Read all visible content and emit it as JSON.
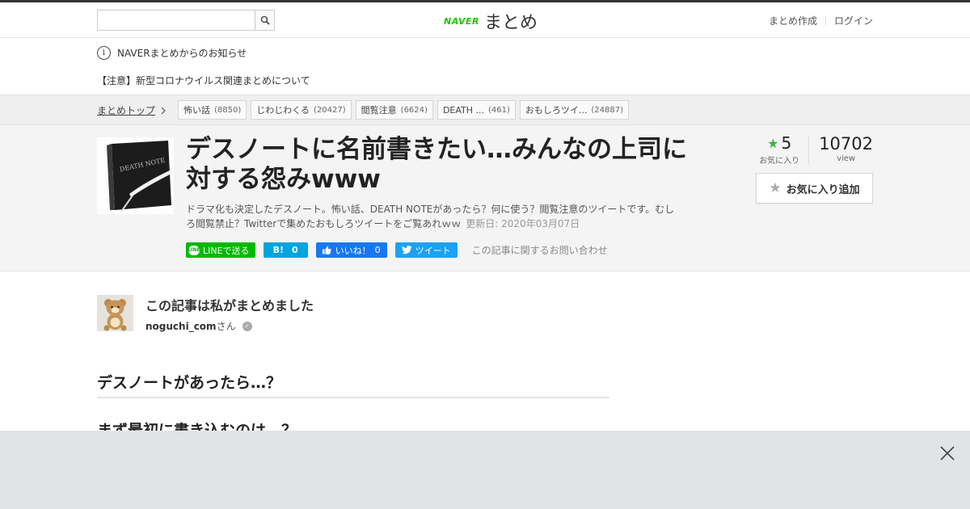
{
  "header": {
    "search_placeholder": "",
    "logo_brand": "NAVER",
    "logo_service": "まとめ",
    "create_link": "まとめ作成",
    "login_link": "ログイン"
  },
  "notices": {
    "heading": "NAVERまとめからのお知らせ",
    "item": "【注意】新型コロナウイルス関連まとめについて"
  },
  "breadcrumb": {
    "top": "まとめトップ",
    "tags": [
      {
        "label": "怖い話",
        "count": "(8850)"
      },
      {
        "label": "じわじわくる",
        "count": "(20427)"
      },
      {
        "label": "閲覧注意",
        "count": "(6624)"
      },
      {
        "label": "DEATH ...",
        "count": "(461)"
      },
      {
        "label": "おもしろツイ...",
        "count": "(24887)"
      }
    ]
  },
  "article": {
    "title": "デスノートに名前書きたい…みんなの上司に対する怨みwww",
    "description": "ドラマ化も決定したデスノート。怖い話、DEATH NOTEがあったら？何に使う？閲覧注意のツイートです。むしろ閲覧禁止？Twitterで集めたおもしろツイートをご覧あれｗｗ",
    "updated": "更新日: 2020年03月07日",
    "thumbnail_text": "DEATH NOTE"
  },
  "share": {
    "line": "LINEで送る",
    "hatena_count": "0",
    "fb_label": "いいね！",
    "fb_count": "0",
    "tweet": "ツイート",
    "contact": "この記事に関するお問い合わせ"
  },
  "stats": {
    "favorites": "5",
    "favorites_label": "お気に入り",
    "views": "10702",
    "views_label": "view",
    "add_favorite": "お気に入り追加"
  },
  "author": {
    "heading": "この記事は私がまとめました",
    "name": "noguchi_com",
    "suffix": "さん"
  },
  "content": {
    "heading1": "デスノートがあったら…？",
    "heading2": "まず最初に書き込むのは…？"
  },
  "colors": {
    "naver_green": "#1ec800",
    "line_green": "#00b900",
    "hatena_blue": "#00a4de",
    "facebook_blue": "#1877f2",
    "twitter_blue": "#1da1f2",
    "favorite_star": "#3cb043"
  }
}
